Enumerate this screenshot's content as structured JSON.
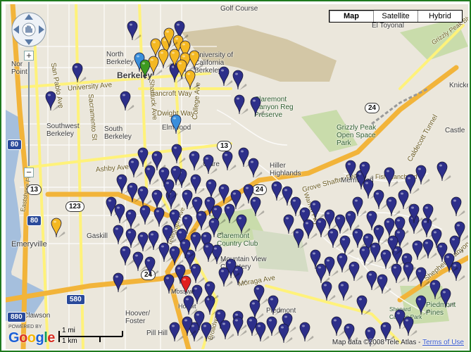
{
  "map_type_control": {
    "buttons": [
      {
        "label": "Map",
        "selected": true
      },
      {
        "label": "Satellite",
        "selected": false
      },
      {
        "label": "Hybrid",
        "selected": false
      }
    ]
  },
  "nav": {
    "pan_icon": "hand-icon",
    "zoom_in": "+",
    "zoom_out": "−"
  },
  "place_labels": {
    "golf_course": "Golf Course",
    "el_toyonal": "El Toyonal",
    "north_berkeley": "North Berkeley",
    "university_of_california": "University of California Berkeley",
    "berkeley": "Berkeley",
    "university_ave": "University Ave",
    "bancroft_way": "Bancroft Way",
    "dwight_way": "Dwight Way",
    "claremont_canyon": "Claremont Canyon Reg Preserve",
    "southwest_berkeley": "Southwest Berkeley",
    "south_berkeley": "South Berkeley",
    "elmwood": "Elmwood",
    "grizzly_peak": "Grizzly Peak Open Space Park",
    "caldecott_tunnel": "Caldecott Tunnel",
    "grove_shafter_fwy": "Grove Shafter Fwy",
    "ashby_ave": "Ashby Ave",
    "hiller_highlands": "Hiller Highlands",
    "merriwood": "Merriwood",
    "claremont": "Clare",
    "emeryville": "Emeryville",
    "gaskill": "Gaskill",
    "claremont_country_club": "Claremont Country Club",
    "mountain_view_cemetery": "Mountain View Cemetery",
    "piedmont": "Piedmont",
    "piedmont_pines": "Piedmont Pines",
    "shepard_canyon": "Shepard Canyon Park",
    "clawson": "Clawson",
    "hoover_foster": "Hoover/ Foster",
    "pill_hill": "Pill Hill",
    "castle": "Castle",
    "knicke": "Knicke",
    "san_pablo_ave": "San Pablo Ave",
    "shattuck_ave": "Shattuck Ave",
    "college_ave": "College Ave",
    "moraga_ave": "Moraga Ave",
    "shepherd_canyon_rd": "Shepherd Canyon Rd",
    "eastshore_fwy": "Eastshore Fwy",
    "sacramento_st": "Sacramento St",
    "telegraph_ave": "Telegraph Ave",
    "broadway": "Broadway",
    "warren_fwy": "Warren Fwy",
    "fish_ranch_rd": "Fish Ranch Rd",
    "grizzly_peak_blvd": "Grizzly Peak Blvd",
    "north_point": "Nor Point",
    "mosswo": "Mosswo",
    "hospit": "Hospit"
  },
  "route_shields": {
    "r13a": "13",
    "r13b": "13",
    "r24a": "24",
    "r24b": "24",
    "r24c": "24",
    "r123": "123",
    "i80a": "80",
    "i80b": "80",
    "i580": "580",
    "i880": "880"
  },
  "footer": {
    "powered_by": "POWERED BY",
    "logo": "Google",
    "scale_mi": "1 mi",
    "scale_km": "1 km",
    "attribution": "Map data ©2008 Tele Atlas -",
    "terms_link": "Terms of Use"
  },
  "colors": {
    "map_bg": "#ebe7dc",
    "freeway": "#f2b43a",
    "major_road": "#fff27a",
    "water": "#a5bfdd",
    "park": "#c9dcab",
    "campus": "#d3c7a6",
    "marker_navy": "#2d2f8a",
    "marker_yellow": "#f4b822",
    "marker_blue": "#3a8fdb",
    "marker_green": "#3d9a1f",
    "marker_red": "#e01e1e",
    "frame_border": "#1f7a1f"
  },
  "markers": {
    "count_navy": 170,
    "count_yellow": 13,
    "count_blue": 2,
    "count_green": 1,
    "count_red": 1
  }
}
